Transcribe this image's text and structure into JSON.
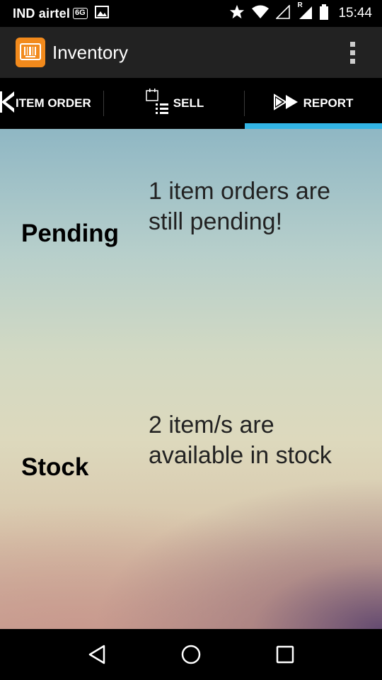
{
  "status_bar": {
    "carrier": "IND airtel",
    "network_badge": "6G",
    "time": "15:44",
    "roaming_indicator": "R",
    "icons": [
      "lte-icon",
      "image-notification-icon",
      "star-icon",
      "wifi-icon",
      "signal-icon",
      "signal-roaming-icon",
      "battery-icon"
    ]
  },
  "action_bar": {
    "title": "Inventory",
    "app_icon": "barcode-app-icon",
    "overflow_icon": "overflow-menu-icon"
  },
  "tabs": [
    {
      "label": "ITEM ORDER",
      "icon": "back-arrow-icon",
      "active": false
    },
    {
      "label": "SELL",
      "icon": "sell-list-icon",
      "active": false
    },
    {
      "label": "REPORT",
      "icon": "fast-forward-icon",
      "active": true
    }
  ],
  "report": {
    "pending": {
      "label": "Pending",
      "message": "1 item orders are still pending!"
    },
    "stock": {
      "label": "Stock",
      "message": "2 item/s are available in stock"
    }
  },
  "nav_bar": {
    "icons": [
      "back-triangle-icon",
      "home-circle-icon",
      "recents-square-icon"
    ]
  },
  "colors": {
    "accent": "#33b5e5",
    "app_icon_bg": "#f28a1c",
    "action_bar_bg": "#222222"
  }
}
